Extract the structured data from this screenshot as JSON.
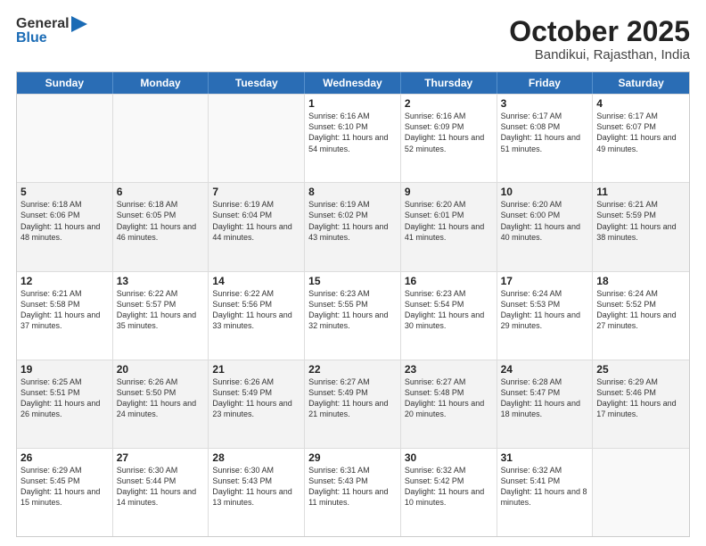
{
  "header": {
    "logo_line1": "General",
    "logo_line2": "Blue",
    "month": "October 2025",
    "location": "Bandikui, Rajasthan, India"
  },
  "days_of_week": [
    "Sunday",
    "Monday",
    "Tuesday",
    "Wednesday",
    "Thursday",
    "Friday",
    "Saturday"
  ],
  "weeks": [
    [
      {
        "day": "",
        "empty": true
      },
      {
        "day": "",
        "empty": true
      },
      {
        "day": "",
        "empty": true
      },
      {
        "day": "1",
        "rise": "6:16 AM",
        "set": "6:10 PM",
        "daylight": "11 hours and 54 minutes."
      },
      {
        "day": "2",
        "rise": "6:16 AM",
        "set": "6:09 PM",
        "daylight": "11 hours and 52 minutes."
      },
      {
        "day": "3",
        "rise": "6:17 AM",
        "set": "6:08 PM",
        "daylight": "11 hours and 51 minutes."
      },
      {
        "day": "4",
        "rise": "6:17 AM",
        "set": "6:07 PM",
        "daylight": "11 hours and 49 minutes."
      }
    ],
    [
      {
        "day": "5",
        "rise": "6:18 AM",
        "set": "6:06 PM",
        "daylight": "11 hours and 48 minutes."
      },
      {
        "day": "6",
        "rise": "6:18 AM",
        "set": "6:05 PM",
        "daylight": "11 hours and 46 minutes."
      },
      {
        "day": "7",
        "rise": "6:19 AM",
        "set": "6:04 PM",
        "daylight": "11 hours and 44 minutes."
      },
      {
        "day": "8",
        "rise": "6:19 AM",
        "set": "6:02 PM",
        "daylight": "11 hours and 43 minutes."
      },
      {
        "day": "9",
        "rise": "6:20 AM",
        "set": "6:01 PM",
        "daylight": "11 hours and 41 minutes."
      },
      {
        "day": "10",
        "rise": "6:20 AM",
        "set": "6:00 PM",
        "daylight": "11 hours and 40 minutes."
      },
      {
        "day": "11",
        "rise": "6:21 AM",
        "set": "5:59 PM",
        "daylight": "11 hours and 38 minutes."
      }
    ],
    [
      {
        "day": "12",
        "rise": "6:21 AM",
        "set": "5:58 PM",
        "daylight": "11 hours and 37 minutes."
      },
      {
        "day": "13",
        "rise": "6:22 AM",
        "set": "5:57 PM",
        "daylight": "11 hours and 35 minutes."
      },
      {
        "day": "14",
        "rise": "6:22 AM",
        "set": "5:56 PM",
        "daylight": "11 hours and 33 minutes."
      },
      {
        "day": "15",
        "rise": "6:23 AM",
        "set": "5:55 PM",
        "daylight": "11 hours and 32 minutes."
      },
      {
        "day": "16",
        "rise": "6:23 AM",
        "set": "5:54 PM",
        "daylight": "11 hours and 30 minutes."
      },
      {
        "day": "17",
        "rise": "6:24 AM",
        "set": "5:53 PM",
        "daylight": "11 hours and 29 minutes."
      },
      {
        "day": "18",
        "rise": "6:24 AM",
        "set": "5:52 PM",
        "daylight": "11 hours and 27 minutes."
      }
    ],
    [
      {
        "day": "19",
        "rise": "6:25 AM",
        "set": "5:51 PM",
        "daylight": "11 hours and 26 minutes."
      },
      {
        "day": "20",
        "rise": "6:26 AM",
        "set": "5:50 PM",
        "daylight": "11 hours and 24 minutes."
      },
      {
        "day": "21",
        "rise": "6:26 AM",
        "set": "5:49 PM",
        "daylight": "11 hours and 23 minutes."
      },
      {
        "day": "22",
        "rise": "6:27 AM",
        "set": "5:49 PM",
        "daylight": "11 hours and 21 minutes."
      },
      {
        "day": "23",
        "rise": "6:27 AM",
        "set": "5:48 PM",
        "daylight": "11 hours and 20 minutes."
      },
      {
        "day": "24",
        "rise": "6:28 AM",
        "set": "5:47 PM",
        "daylight": "11 hours and 18 minutes."
      },
      {
        "day": "25",
        "rise": "6:29 AM",
        "set": "5:46 PM",
        "daylight": "11 hours and 17 minutes."
      }
    ],
    [
      {
        "day": "26",
        "rise": "6:29 AM",
        "set": "5:45 PM",
        "daylight": "11 hours and 15 minutes."
      },
      {
        "day": "27",
        "rise": "6:30 AM",
        "set": "5:44 PM",
        "daylight": "11 hours and 14 minutes."
      },
      {
        "day": "28",
        "rise": "6:30 AM",
        "set": "5:43 PM",
        "daylight": "11 hours and 13 minutes."
      },
      {
        "day": "29",
        "rise": "6:31 AM",
        "set": "5:43 PM",
        "daylight": "11 hours and 11 minutes."
      },
      {
        "day": "30",
        "rise": "6:32 AM",
        "set": "5:42 PM",
        "daylight": "11 hours and 10 minutes."
      },
      {
        "day": "31",
        "rise": "6:32 AM",
        "set": "5:41 PM",
        "daylight": "11 hours and 8 minutes."
      },
      {
        "day": "",
        "empty": true
      }
    ]
  ]
}
